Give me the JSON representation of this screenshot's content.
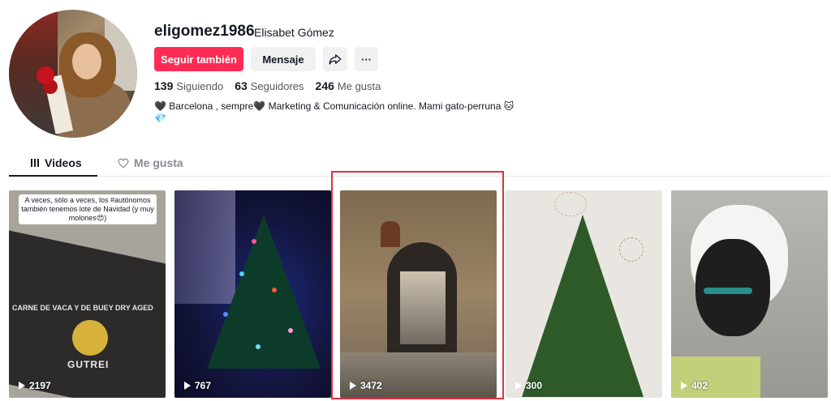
{
  "profile": {
    "username": "eligomez1986",
    "nickname": "Elisabet Gómez",
    "follow_label": "Seguir también",
    "message_label": "Mensaje",
    "more_label": "···",
    "stats": {
      "following_count": "139",
      "following_label": "Siguiendo",
      "followers_count": "63",
      "followers_label": "Seguidores",
      "likes_count": "246",
      "likes_label": "Me gusta"
    },
    "bio_line1": "🖤 Barcelona , sempre🖤 Marketing & Comunicación online. Mami gato-perruna 🐱",
    "bio_line2": "💎"
  },
  "tabs": {
    "videos_label": "Videos",
    "likes_label": "Me gusta",
    "active": "Videos"
  },
  "videos": [
    {
      "views": "2197",
      "caption": "A veces, sólo a veces, los #autónomos también tenemos lote de Navidad (y muy molones😍)",
      "box_side_text": "CARNE DE VACA Y DE BUEY DRY AGED",
      "brand_text": "GUTREI"
    },
    {
      "views": "767"
    },
    {
      "views": "3472"
    },
    {
      "views": "300"
    },
    {
      "views": "402"
    }
  ],
  "colors": {
    "follow_button": "#fe2c55",
    "highlight_border": "#e0303f"
  },
  "icons": {
    "share": "share-arrow-icon",
    "play": "play-icon",
    "videos_tab": "grid-icon",
    "likes_tab": "heart-outline-icon"
  }
}
